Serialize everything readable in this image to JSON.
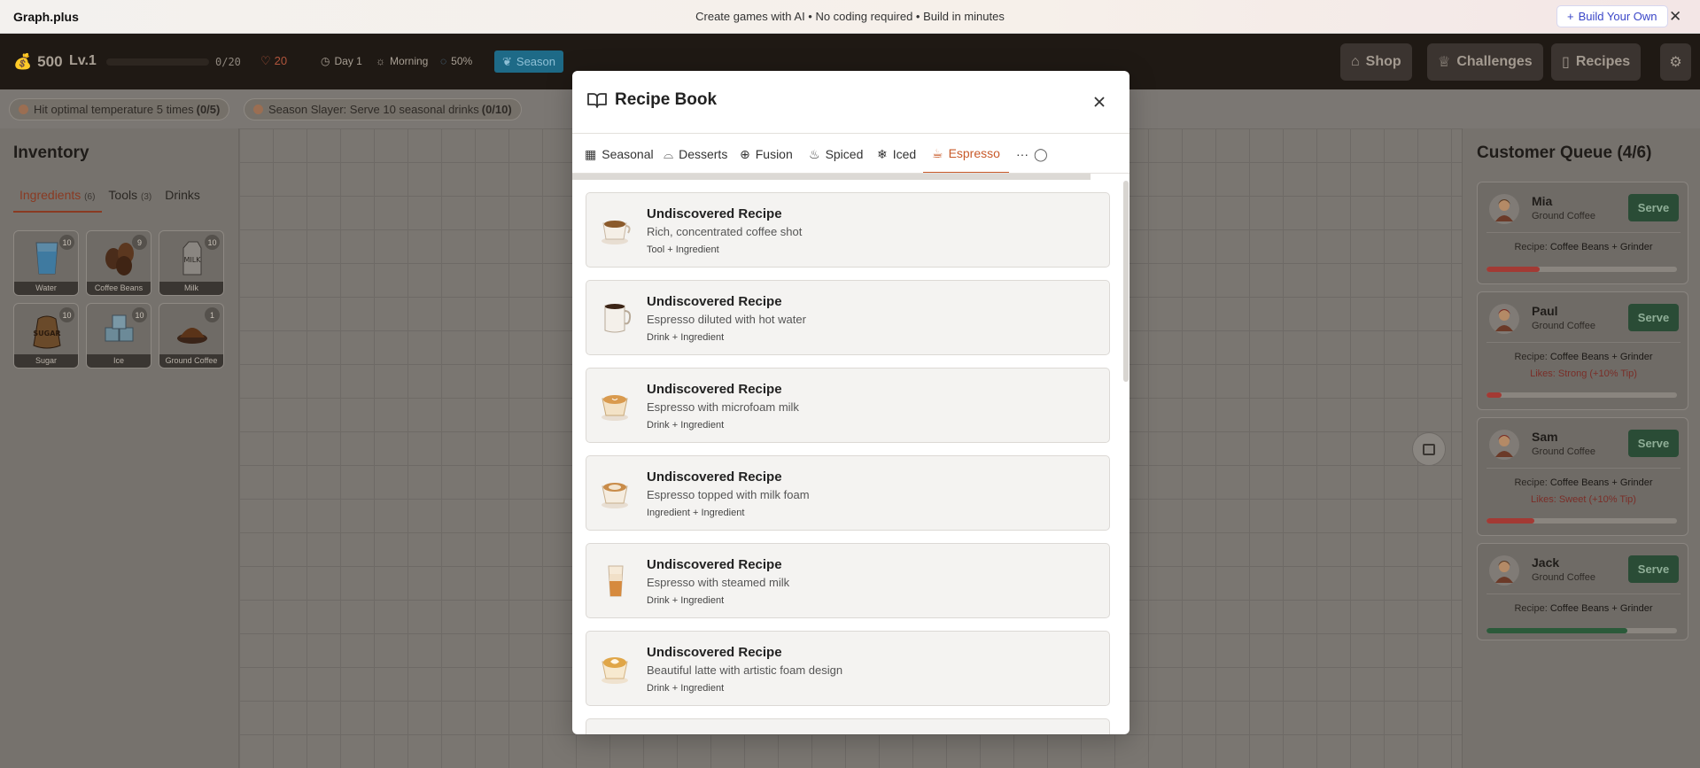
{
  "promo": {
    "brand": "Graph.plus",
    "tagline": "Create games with AI • No coding required • Build in minutes",
    "build_label": "Build Your Own"
  },
  "hud": {
    "coins": "500",
    "level": "Lv.1",
    "xp": "0/20",
    "hearts": "20",
    "day": "Day 1",
    "time": "Morning",
    "weather": "50%",
    "season": "Season",
    "xp_progress": 0
  },
  "top_buttons": {
    "shop": "Shop",
    "challenges": "Challenges",
    "recipes": "Recipes"
  },
  "challenges": [
    {
      "text": "Hit optimal temperature 5 times ",
      "progress": "(0/5)"
    },
    {
      "text": "Season Slayer: Serve 10 seasonal drinks ",
      "progress": "(0/10)"
    }
  ],
  "inventory": {
    "title": "Inventory",
    "tabs": [
      {
        "label": "Ingredients",
        "count": "(6)"
      },
      {
        "label": "Tools",
        "count": "(3)"
      },
      {
        "label": "Drinks",
        "count": ""
      }
    ],
    "items": [
      {
        "name": "Water",
        "count": "10",
        "icon": "water-glass-icon"
      },
      {
        "name": "Coffee Beans",
        "count": "9",
        "icon": "coffee-beans-icon"
      },
      {
        "name": "Milk",
        "count": "10",
        "icon": "milk-carton-icon"
      },
      {
        "name": "Sugar",
        "count": "10",
        "icon": "sugar-sack-icon"
      },
      {
        "name": "Ice",
        "count": "10",
        "icon": "ice-cubes-icon"
      },
      {
        "name": "Ground Coffee",
        "count": "1",
        "icon": "ground-coffee-icon"
      }
    ]
  },
  "modal": {
    "title": "Recipe Book",
    "tabs": [
      "Seasonal",
      "Desserts",
      "Fusion",
      "Spiced",
      "Iced",
      "Espresso"
    ],
    "active_tab": "Espresso",
    "recipes": [
      {
        "title": "Undiscovered Recipe",
        "desc": "Rich, concentrated coffee shot",
        "combo": "Tool + Ingredient",
        "icon": "espresso-cup-icon"
      },
      {
        "title": "Undiscovered Recipe",
        "desc": "Espresso diluted with hot water",
        "combo": "Drink + Ingredient",
        "icon": "americano-mug-icon"
      },
      {
        "title": "Undiscovered Recipe",
        "desc": "Espresso with microfoam milk",
        "combo": "Drink + Ingredient",
        "icon": "flat-white-cup-icon"
      },
      {
        "title": "Undiscovered Recipe",
        "desc": "Espresso topped with milk foam",
        "combo": "Ingredient + Ingredient",
        "icon": "cappuccino-cup-icon"
      },
      {
        "title": "Undiscovered Recipe",
        "desc": "Espresso with steamed milk",
        "combo": "Drink + Ingredient",
        "icon": "latte-glass-icon"
      },
      {
        "title": "Undiscovered Recipe",
        "desc": "Beautiful latte with artistic foam design",
        "combo": "Drink + Ingredient",
        "icon": "latte-art-cup-icon"
      }
    ]
  },
  "queue": {
    "title": "Customer Queue (4/6)",
    "serve_label": "Serve",
    "recipe_prefix": "Recipe: ",
    "customers": [
      {
        "name": "Mia",
        "order": "Ground Coffee",
        "recipe": "Coffee Beans + Grinder",
        "likes": "",
        "patience": 0.28,
        "color": "#a33a34"
      },
      {
        "name": "Paul",
        "order": "Ground Coffee",
        "recipe": "Coffee Beans + Grinder",
        "likes": "Likes: Strong (+10% Tip)",
        "patience": 0.08,
        "color": "#a33a34"
      },
      {
        "name": "Sam",
        "order": "Ground Coffee",
        "recipe": "Coffee Beans + Grinder",
        "likes": "Likes: Sweet (+10% Tip)",
        "patience": 0.25,
        "color": "#a33a34"
      },
      {
        "name": "Jack",
        "order": "Ground Coffee",
        "recipe": "Coffee Beans + Grinder",
        "likes": "",
        "patience": 0.74,
        "color": "#2b5a3a"
      }
    ]
  }
}
